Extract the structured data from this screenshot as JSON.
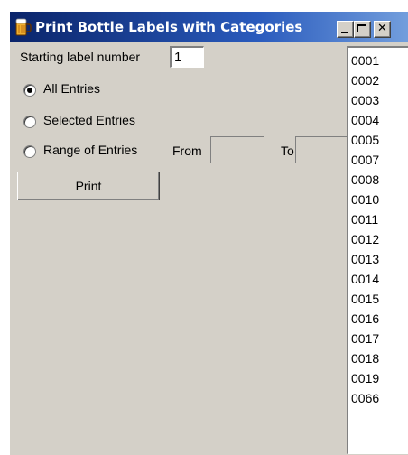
{
  "window": {
    "title": "Print Bottle Labels with Categories",
    "icon": "beer-mug-icon"
  },
  "form": {
    "start_label_text": "Starting label number",
    "start_label_value": "1",
    "radio_all_label": "All Entries",
    "radio_selected_label": "Selected Entries",
    "radio_range_label": "Range of Entries",
    "selected_radio": "All Entries",
    "from_label": "From",
    "from_value": "",
    "to_label": "To",
    "to_value": "",
    "print_label": "Print"
  },
  "entries": [
    "0001",
    "0002",
    "0003",
    "0004",
    "0005",
    "0007",
    "0008",
    "0010",
    "0011",
    "0012",
    "0013",
    "0014",
    "0015",
    "0016",
    "0017",
    "0018",
    "0019",
    "0066"
  ],
  "colors": {
    "title_bar": "#0a246a",
    "face": "#d4d0c8"
  }
}
